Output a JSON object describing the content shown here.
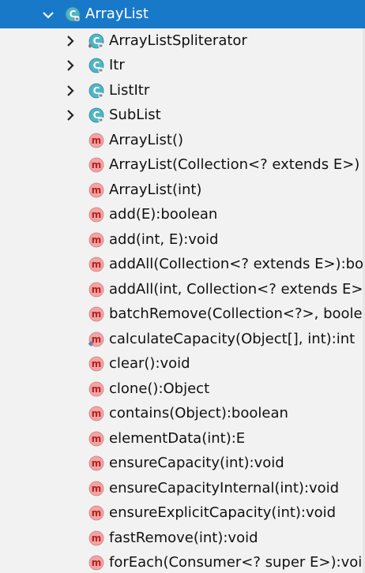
{
  "root": {
    "label": "ArrayList",
    "icon": "class-icon",
    "expanded": true
  },
  "nested_classes": [
    {
      "label": "ArrayListSpliterator",
      "icon": "static-class-icon"
    },
    {
      "label": "Itr",
      "icon": "class-icon"
    },
    {
      "label": "ListItr",
      "icon": "class-icon"
    },
    {
      "label": "SubList",
      "icon": "class-icon"
    }
  ],
  "methods": [
    {
      "label": "ArrayList()",
      "icon": "method-icon"
    },
    {
      "label": "ArrayList(Collection<? extends E>)",
      "icon": "method-icon"
    },
    {
      "label": "ArrayList(int)",
      "icon": "method-icon"
    },
    {
      "label": "add(E):boolean",
      "icon": "method-icon"
    },
    {
      "label": "add(int, E):void",
      "icon": "method-icon"
    },
    {
      "label": "addAll(Collection<? extends E>):boole",
      "icon": "method-icon"
    },
    {
      "label": "addAll(int, Collection<? extends E>):b",
      "icon": "method-icon"
    },
    {
      "label": "batchRemove(Collection<?>, boolean",
      "icon": "method-icon"
    },
    {
      "label": "calculateCapacity(Object[], int):int",
      "icon": "static-method-icon"
    },
    {
      "label": "clear():void",
      "icon": "method-icon"
    },
    {
      "label": "clone():Object",
      "icon": "method-icon"
    },
    {
      "label": "contains(Object):boolean",
      "icon": "method-icon"
    },
    {
      "label": "elementData(int):E",
      "icon": "method-icon"
    },
    {
      "label": "ensureCapacity(int):void",
      "icon": "method-icon"
    },
    {
      "label": "ensureCapacityInternal(int):void",
      "icon": "method-icon"
    },
    {
      "label": "ensureExplicitCapacity(int):void",
      "icon": "method-icon"
    },
    {
      "label": "fastRemove(int):void",
      "icon": "method-icon"
    },
    {
      "label": "forEach(Consumer<? super E>):void",
      "icon": "method-icon"
    }
  ],
  "colors": {
    "selection": "#1979c9",
    "class_icon": "#4fb5c5",
    "method_icon": "#f2a4a4",
    "method_letter": "#b51f1f",
    "lock_badge": "#8a8a8a"
  }
}
